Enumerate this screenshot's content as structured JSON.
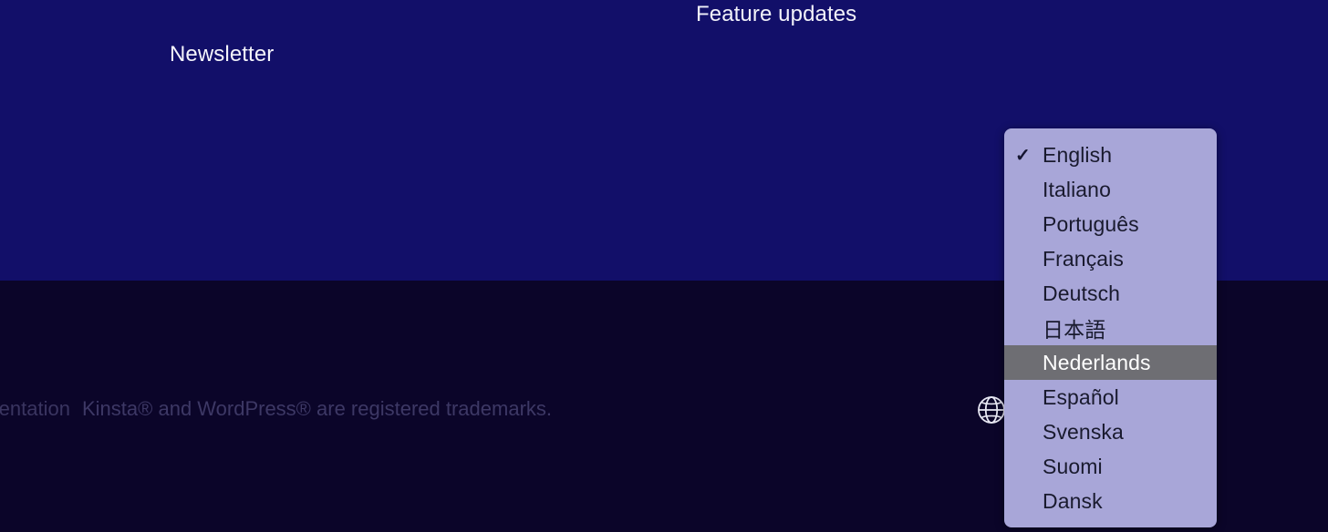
{
  "page": {
    "upper_band_color": "#120f69",
    "footer_band_color": "#0b0529"
  },
  "upper": {
    "feature_updates_label": "Feature updates",
    "newsletter_label": "Newsletter"
  },
  "footer": {
    "clipped_link_label": "Documentation",
    "trademark_text": "Kinsta® and WordPress® are registered trademarks.",
    "globe_icon": "globe-icon",
    "text_color": "#3d3865"
  },
  "language_dropdown": {
    "background_color": "#a8a6d8",
    "highlight_color": "#6e6e73",
    "text_color": "#191a2e",
    "checkmark": "✓",
    "selected_value": "English",
    "hovered_value": "Nederlands",
    "options": [
      {
        "label": "English",
        "checked": true,
        "highlighted": false
      },
      {
        "label": "Italiano",
        "checked": false,
        "highlighted": false
      },
      {
        "label": "Português",
        "checked": false,
        "highlighted": false
      },
      {
        "label": "Français",
        "checked": false,
        "highlighted": false
      },
      {
        "label": "Deutsch",
        "checked": false,
        "highlighted": false
      },
      {
        "label": "日本語",
        "checked": false,
        "highlighted": false
      },
      {
        "label": "Nederlands",
        "checked": false,
        "highlighted": true
      },
      {
        "label": "Español",
        "checked": false,
        "highlighted": false
      },
      {
        "label": "Svenska",
        "checked": false,
        "highlighted": false
      },
      {
        "label": "Suomi",
        "checked": false,
        "highlighted": false
      },
      {
        "label": "Dansk",
        "checked": false,
        "highlighted": false
      }
    ]
  }
}
